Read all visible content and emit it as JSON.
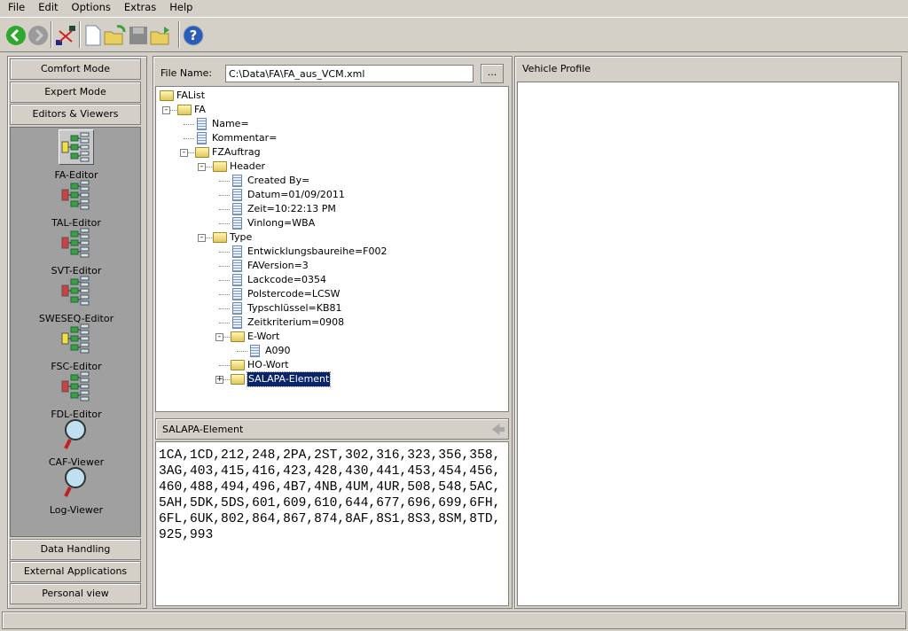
{
  "menu": [
    "File",
    "Edit",
    "Options",
    "Extras",
    "Help"
  ],
  "toolbar": [
    {
      "name": "back-icon",
      "color": "#2ea82e",
      "enabled": true
    },
    {
      "name": "forward-icon",
      "color": "#9a9a9a",
      "enabled": false
    },
    {
      "name": "connect-icon",
      "color": "#c02020",
      "enabled": true
    },
    {
      "name": "new-file-icon",
      "color": "#ffffff",
      "enabled": true
    },
    {
      "name": "open-folder-icon",
      "color": "#e8d060",
      "enabled": true
    },
    {
      "name": "save-icon",
      "color": "#8a8a8a",
      "enabled": false
    },
    {
      "name": "open-recent-icon",
      "color": "#e8d060",
      "enabled": true
    },
    {
      "name": "help-icon",
      "color": "#2a5cb8",
      "enabled": true
    }
  ],
  "sidebar": {
    "top_buttons": [
      "Comfort Mode",
      "Expert Mode",
      "Editors & Viewers"
    ],
    "tools": [
      {
        "label": "FA-Editor",
        "icon": "fa-editor-icon",
        "selected": true
      },
      {
        "label": "TAL-Editor",
        "icon": "tal-editor-icon"
      },
      {
        "label": "SVT-Editor",
        "icon": "svt-editor-icon"
      },
      {
        "label": "SWESEQ-Editor",
        "icon": "sweseq-editor-icon"
      },
      {
        "label": "FSC-Editor",
        "icon": "fsc-editor-icon"
      },
      {
        "label": "FDL-Editor",
        "icon": "fdl-editor-icon"
      },
      {
        "label": "CAF-Viewer",
        "icon": "magnifier-icon"
      },
      {
        "label": "Log-Viewer",
        "icon": "magnifier-icon"
      }
    ],
    "bottom_buttons": [
      "Data Handling",
      "External Applications",
      "Personal view"
    ]
  },
  "file": {
    "label": "File Name:",
    "value": "C:\\Data\\FA\\FA_aus_VCM.xml",
    "browse": "..."
  },
  "tree": [
    {
      "t": "FAList",
      "d": 0,
      "k": "folder"
    },
    {
      "t": "FA",
      "d": 1,
      "k": "folder",
      "e": "-"
    },
    {
      "t": "Name=",
      "d": 2,
      "k": "doc"
    },
    {
      "t": "Kommentar=",
      "d": 2,
      "k": "doc"
    },
    {
      "t": "FZAuftrag",
      "d": 2,
      "k": "folder",
      "e": "-"
    },
    {
      "t": "Header",
      "d": 3,
      "k": "folder",
      "e": "-"
    },
    {
      "t": "Created By=",
      "d": 4,
      "k": "doc"
    },
    {
      "t": "Datum=01/09/2011",
      "d": 4,
      "k": "doc"
    },
    {
      "t": "Zeit=10:22:13 PM",
      "d": 4,
      "k": "doc"
    },
    {
      "t": "Vinlong=WBA",
      "d": 4,
      "k": "doc"
    },
    {
      "t": "Type",
      "d": 3,
      "k": "folder",
      "e": "-"
    },
    {
      "t": "Entwicklungsbaureihe=F002",
      "d": 4,
      "k": "doc"
    },
    {
      "t": "FAVersion=3",
      "d": 4,
      "k": "doc"
    },
    {
      "t": "Lackcode=0354",
      "d": 4,
      "k": "doc"
    },
    {
      "t": "Polstercode=LCSW",
      "d": 4,
      "k": "doc"
    },
    {
      "t": "Typschlüssel=KB81",
      "d": 4,
      "k": "doc"
    },
    {
      "t": "Zeitkriterium=0908",
      "d": 4,
      "k": "doc"
    },
    {
      "t": "E-Wort",
      "d": 4,
      "k": "folder",
      "e": "-"
    },
    {
      "t": "A090",
      "d": 5,
      "k": "doc"
    },
    {
      "t": "HO-Wort",
      "d": 4,
      "k": "folder"
    },
    {
      "t": "SALAPA-Element",
      "d": 4,
      "k": "folder",
      "e": "+",
      "selected": true
    }
  ],
  "detail": {
    "title": "SALAPA-Element",
    "value": "1CA,1CD,212,248,2PA,2ST,302,316,323,356,358,3AG,403,415,416,423,428,430,441,453,454,456,460,488,494,496,4B7,4NB,4UM,4UR,508,548,5AC,5AH,5DK,5DS,601,609,610,644,677,696,699,6FH,6FL,6UK,802,864,867,874,8AF,8S1,8S3,8SM,8TD,925,993"
  },
  "vehicle_profile": {
    "title": "Vehicle Profile"
  },
  "colors": {
    "selection": "#0a246a",
    "sidebar_tools_bg": "#a0a0a0"
  }
}
